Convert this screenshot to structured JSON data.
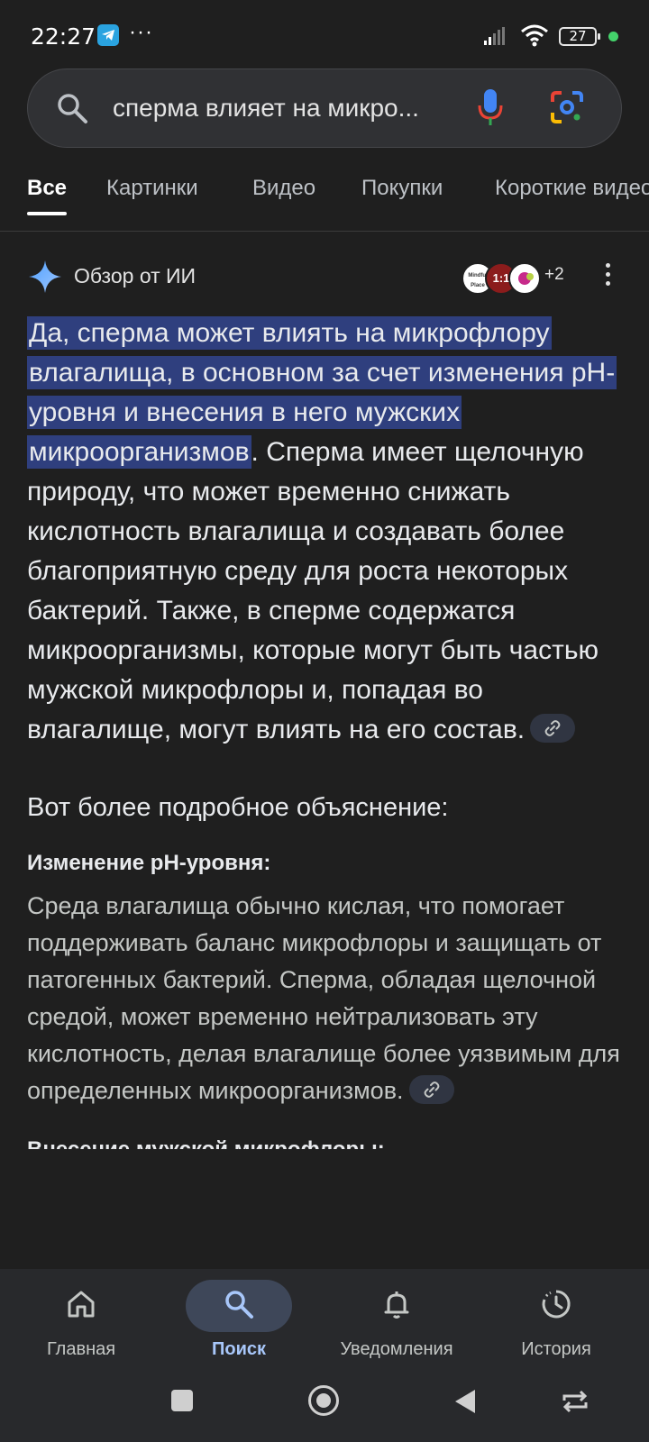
{
  "status_bar": {
    "time": "22:27",
    "dots": "···",
    "battery": "27"
  },
  "search": {
    "query": "сперма влияет на микро..."
  },
  "tabs": [
    {
      "label": "Все"
    },
    {
      "label": "Картинки"
    },
    {
      "label": "Видео"
    },
    {
      "label": "Покупки"
    },
    {
      "label": "Короткие видео"
    }
  ],
  "ai_overview": {
    "title": "Обзор от ИИ",
    "sources_more": "+2",
    "source_logos": [
      {
        "label": "Mindful Place"
      },
      {
        "label": "1:1"
      },
      {
        "label": ""
      }
    ],
    "lead_highlighted": "Да, сперма может влиять на микрофлору влагалища, в основном за счет изменения pH-уровня и внесения в него мужских микроорганизмов",
    "lead_rest": ". Сперма имеет щелочную природу, что может временно снижать кислотность влагалища и создавать более благоприятную среду для роста некоторых бактерий. Также, в сперме содержатся микроорганизмы, которые могут быть частью мужской микрофлоры и, попадая во влагалище, могут влиять на его состав.",
    "details_heading": "Вот более подробное объяснение:",
    "section1_title": "Изменение pH-уровня:",
    "section1_text": "Среда влагалища обычно кислая, что помогает поддерживать баланс микрофлоры и защищать от патогенных бактерий. Сперма, обладая щелочной средой, может временно нейтрализовать эту кислотность, делая влагалище более уязвимым для определенных микроорганизмов.",
    "section2_title": "Внесение мужской микрофлоры:"
  },
  "bottom_nav": [
    {
      "label": "Главная",
      "icon": "home-icon"
    },
    {
      "label": "Поиск",
      "icon": "search-icon"
    },
    {
      "label": "Уведомления",
      "icon": "bell-icon"
    },
    {
      "label": "История",
      "icon": "history-icon"
    }
  ],
  "colors": {
    "highlight": "#2f3f7e",
    "accent": "#a8c7fa",
    "background": "#1f1f1f"
  }
}
